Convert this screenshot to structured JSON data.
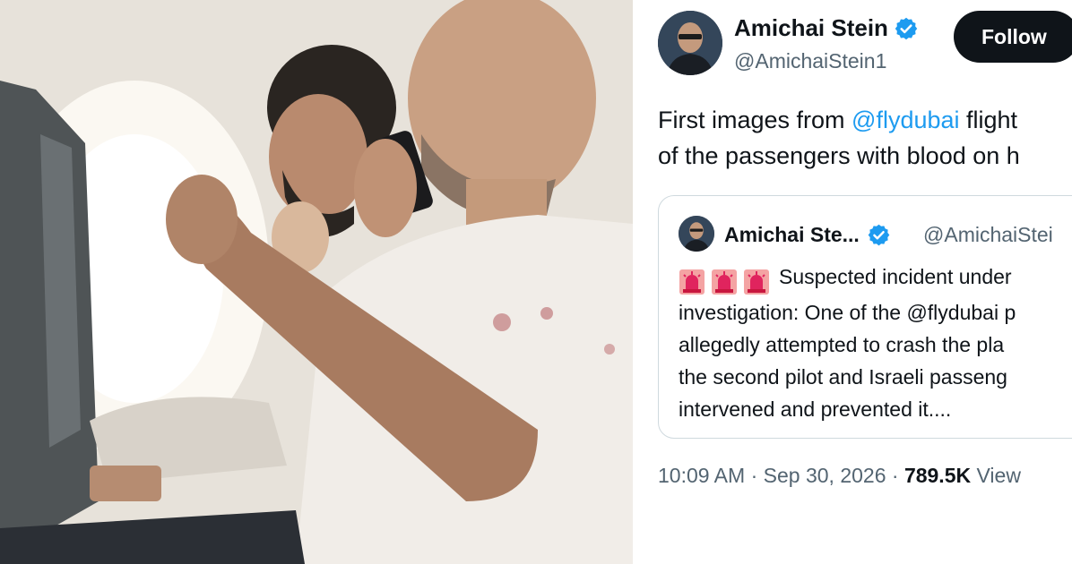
{
  "tweet": {
    "author": {
      "name": "Amichai Stein",
      "handle": "@AmichaiStein1"
    },
    "follow_label": "Follow",
    "text": {
      "line1_prefix": "First images from ",
      "line1_mention": "@flydubai",
      "line1_suffix": " flight",
      "line2": "of the passengers with blood on h"
    },
    "quote": {
      "name": "Amichai Ste...",
      "handle": "@AmichaiStei",
      "siren_icon": "police-siren-emoji",
      "lines": [
        "Suspected incident under",
        "investigation: One of the @flydubai p",
        "allegedly attempted to crash the pla",
        "the second pilot and Israeli passeng",
        "intervened and prevented it...."
      ]
    },
    "meta": {
      "time": "10:09 AM",
      "sep1": " · ",
      "date": "Sep 30, 2026",
      "sep2": " · ",
      "views_count": "789.5K",
      "views_label": " View"
    },
    "colors": {
      "link": "#1d9bf0",
      "verified": "#1d9bf0",
      "follow_bg": "#0f1419",
      "secondary_text": "#536471"
    }
  }
}
